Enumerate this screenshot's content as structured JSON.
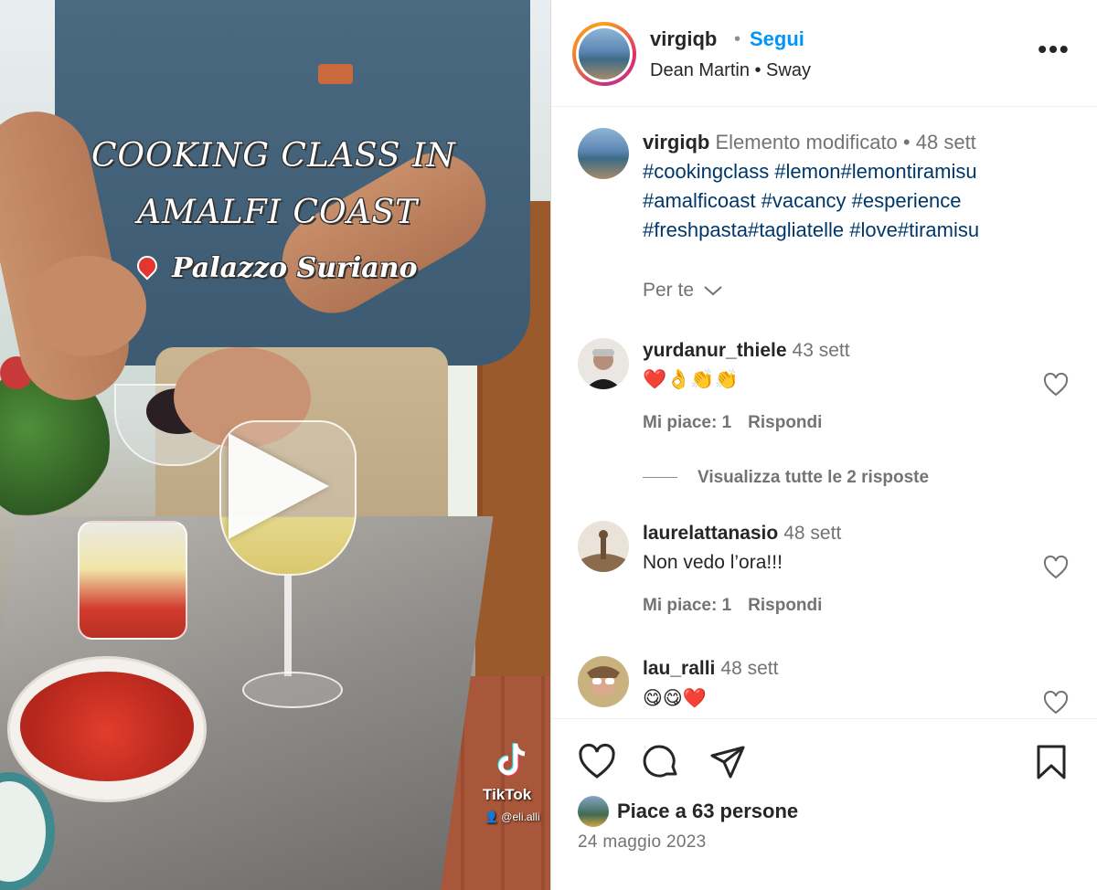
{
  "video": {
    "caption_line1": "COOKING CLASS IN",
    "caption_line2": "AMALFI COAST",
    "caption_line3": "Palazzo Suriano",
    "watermark_name": "TikTok",
    "watermark_handle": "@eli.alli"
  },
  "header": {
    "username": "virgiqb",
    "separator": "•",
    "follow_label": "Segui",
    "audio": "Dean Martin • Sway",
    "more_icon": "more-horizontal-icon"
  },
  "caption": {
    "username": "virgiqb",
    "edited": "Elemento modificato",
    "dot": "•",
    "time": "48 sett",
    "hashtags": "#cookingclass #lemon#lemontiramisu #amalficoast #vacancy #esperience #freshpasta#tagliatelle #love#tiramisu",
    "for_you": "Per te"
  },
  "comments": [
    {
      "username": "yurdanur_thiele",
      "time": "43 sett",
      "text": "❤️👌👏👏",
      "likes": "Mi piace: 1",
      "reply": "Rispondi"
    },
    {
      "username": "laurelattanasio",
      "time": "48 sett",
      "text": "Non vedo l’ora!!!",
      "likes": "Mi piace: 1",
      "reply": "Rispondi"
    },
    {
      "username": "lau_ralli",
      "time": "48 sett",
      "text": "😋😋❤️"
    }
  ],
  "view_replies": "Visualizza tutte le 2 risposte",
  "footer": {
    "likes": "Piace a 63 persone",
    "date": "24 maggio 2023"
  },
  "colors": {
    "link_blue": "#0095f6",
    "hashtag": "#00376b",
    "muted": "#737373"
  }
}
